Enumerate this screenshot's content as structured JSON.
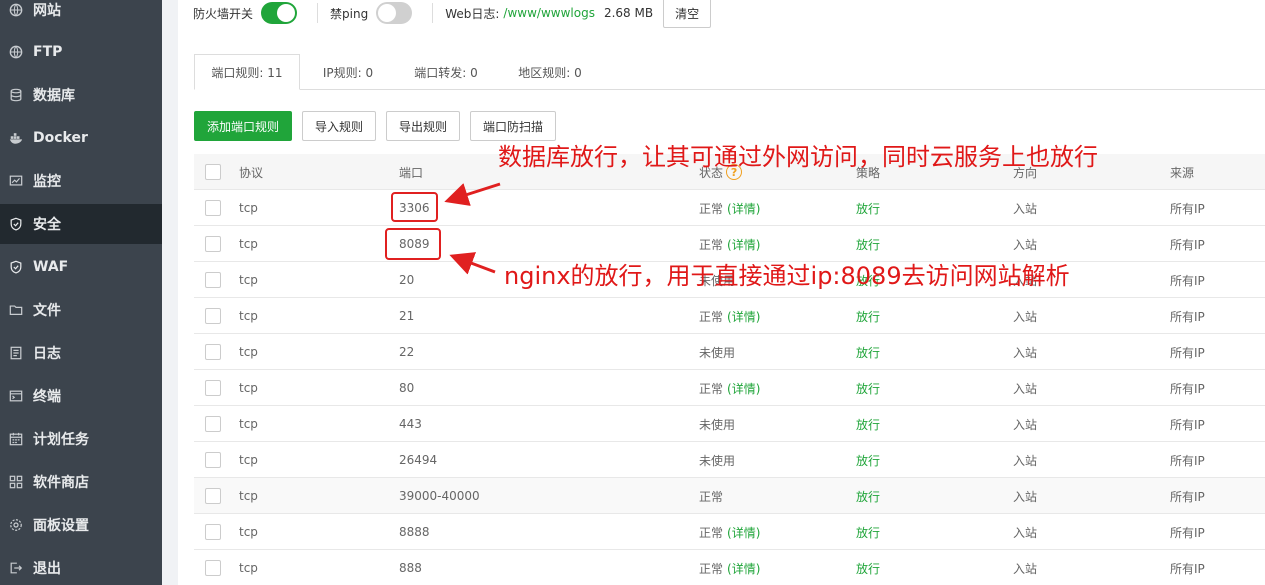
{
  "sidebar": {
    "items": [
      {
        "label": "网站",
        "icon": "globe-icon"
      },
      {
        "label": "FTP",
        "icon": "globe-icon"
      },
      {
        "label": "数据库",
        "icon": "database-icon"
      },
      {
        "label": "Docker",
        "icon": "docker-icon"
      },
      {
        "label": "监控",
        "icon": "monitor-icon"
      },
      {
        "label": "安全",
        "icon": "shield-icon",
        "active": true
      },
      {
        "label": "WAF",
        "icon": "shield-icon"
      },
      {
        "label": "文件",
        "icon": "folder-icon"
      },
      {
        "label": "日志",
        "icon": "log-icon"
      },
      {
        "label": "终端",
        "icon": "terminal-icon"
      },
      {
        "label": "计划任务",
        "icon": "calendar-icon"
      },
      {
        "label": "软件商店",
        "icon": "grid-icon"
      },
      {
        "label": "面板设置",
        "icon": "gear-icon"
      },
      {
        "label": "退出",
        "icon": "exit-icon"
      }
    ]
  },
  "topbar": {
    "firewall_label": "防火墙开关",
    "firewall_on": true,
    "ping_label": "禁ping",
    "ping_on": false,
    "weblog_label": "Web日志:",
    "weblog_path": "/www/wwwlogs",
    "weblog_size": "2.68 MB",
    "clear_label": "清空"
  },
  "tabs": [
    {
      "label": "端口规则: 11",
      "active": true
    },
    {
      "label": "IP规则: 0"
    },
    {
      "label": "端口转发: 0"
    },
    {
      "label": "地区规则: 0"
    }
  ],
  "actions": {
    "add_label": "添加端口规则",
    "import_label": "导入规则",
    "export_label": "导出规则",
    "scan_label": "端口防扫描"
  },
  "table": {
    "headers": {
      "protocol": "协议",
      "port": "端口",
      "status": "状态",
      "policy": "策略",
      "direction": "方向",
      "source": "来源"
    },
    "detail_label": "(详情)",
    "rows": [
      {
        "protocol": "tcp",
        "port": "3306",
        "status": "正常",
        "detail": true,
        "policy": "放行",
        "direction": "入站",
        "source": "所有IP"
      },
      {
        "protocol": "tcp",
        "port": "8089",
        "status": "正常",
        "detail": true,
        "policy": "放行",
        "direction": "入站",
        "source": "所有IP"
      },
      {
        "protocol": "tcp",
        "port": "20",
        "status": "未使用",
        "detail": false,
        "policy": "放行",
        "direction": "入站",
        "source": "所有IP"
      },
      {
        "protocol": "tcp",
        "port": "21",
        "status": "正常",
        "detail": true,
        "policy": "放行",
        "direction": "入站",
        "source": "所有IP"
      },
      {
        "protocol": "tcp",
        "port": "22",
        "status": "未使用",
        "detail": false,
        "policy": "放行",
        "direction": "入站",
        "source": "所有IP"
      },
      {
        "protocol": "tcp",
        "port": "80",
        "status": "正常",
        "detail": true,
        "policy": "放行",
        "direction": "入站",
        "source": "所有IP"
      },
      {
        "protocol": "tcp",
        "port": "443",
        "status": "未使用",
        "detail": false,
        "policy": "放行",
        "direction": "入站",
        "source": "所有IP"
      },
      {
        "protocol": "tcp",
        "port": "26494",
        "status": "未使用",
        "detail": false,
        "policy": "放行",
        "direction": "入站",
        "source": "所有IP"
      },
      {
        "protocol": "tcp",
        "port": "39000-40000",
        "status": "正常",
        "detail": false,
        "policy": "放行",
        "direction": "入站",
        "source": "所有IP"
      },
      {
        "protocol": "tcp",
        "port": "8888",
        "status": "正常",
        "detail": true,
        "policy": "放行",
        "direction": "入站",
        "source": "所有IP"
      },
      {
        "protocol": "tcp",
        "port": "888",
        "status": "正常",
        "detail": true,
        "policy": "放行",
        "direction": "入站",
        "source": "所有IP"
      }
    ]
  },
  "annotations": {
    "note1": "数据库放行，让其可通过外网访问，同时云服务上也放行",
    "note2": "nginx的放行，用于直接通过ip:8089去访问网站解析"
  },
  "colors": {
    "accent": "#20a53a",
    "sidebar_bg": "#3c444d",
    "sidebar_active": "#22292f",
    "annotation": "#e02020"
  }
}
